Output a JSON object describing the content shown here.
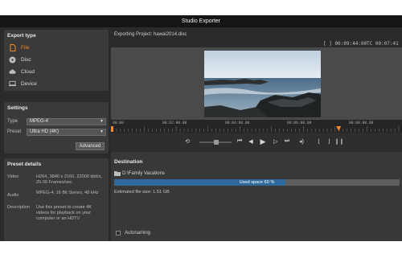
{
  "window": {
    "title": "Studio Exporter"
  },
  "export_type": {
    "title": "Export type",
    "items": [
      {
        "label": "File",
        "icon": "file-icon",
        "active": true
      },
      {
        "label": "Disc",
        "icon": "disc-icon",
        "active": false
      },
      {
        "label": "Cloud",
        "icon": "cloud-icon",
        "active": false
      },
      {
        "label": "Device",
        "icon": "device-icon",
        "active": false
      }
    ]
  },
  "settings": {
    "title": "Settings",
    "type_label": "Type",
    "type_value": "MPEG-4",
    "preset_label": "Preset",
    "preset_value": "Ultra HD (4K)",
    "advanced_label": "Advanced"
  },
  "preset_details": {
    "title": "Preset details",
    "video_label": "Video",
    "video_value": "H264, 3840 x 2160, 22000 kbit/s, 25.00 Frames/sec",
    "audio_label": "Audio",
    "audio_value": "MPEG-4, 16 Bit Stereo, 48 kHz",
    "description_label": "Description",
    "description_value": "Use this preset to create 4K videos for playback on your computer or an HDTV"
  },
  "project": {
    "label": "Exporting Project: hawai2014.disc",
    "in_out": "[ ] 00:09:44:00",
    "tc": "TC 00:07:41"
  },
  "timeline": {
    "ticks": [
      "00:00",
      "00:02:00.00",
      "00:04:00.00",
      "00:06:00.00",
      "00:08:00.00"
    ],
    "playhead_fraction": 0.79
  },
  "destination": {
    "title": "Destination",
    "path": "D:\\Family Vacations",
    "used_space_text": "Used space 60 %",
    "used_fraction": 0.6,
    "estimated_size": "Estimated file size: 1.51 GB",
    "autonaming_label": "Autonaming"
  },
  "colors": {
    "accent": "#f08a2a",
    "progress": "#2e6b9c"
  }
}
